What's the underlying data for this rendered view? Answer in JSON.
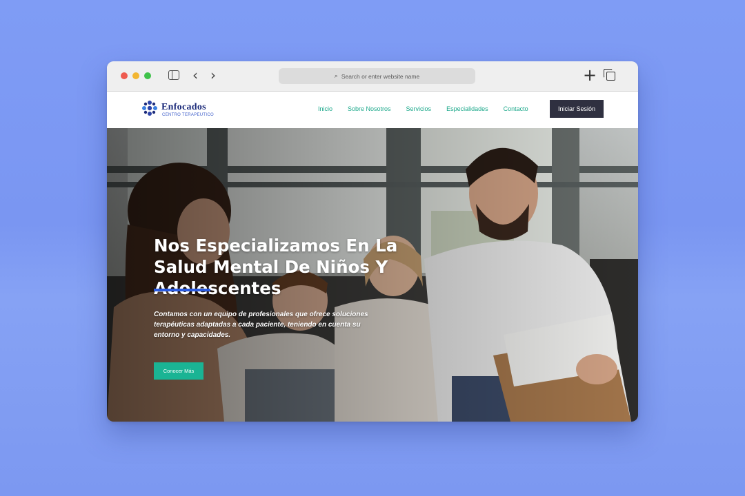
{
  "browser": {
    "address_placeholder": "Search or enter website name",
    "icons": [
      "sidebar-icon",
      "back-arrow-icon",
      "forward-arrow-icon",
      "search-icon",
      "new-tab-icon",
      "tabs-overview-icon"
    ]
  },
  "site": {
    "logo": {
      "name": "Enfocados",
      "subtitle": "CENTRO TERAPEUTICO"
    },
    "nav": [
      "Inicio",
      "Sobre Nosotros",
      "Servicios",
      "Especialidades",
      "Contacto"
    ],
    "login_label": "Iniciar Sesión",
    "accent_color": "#1ab494",
    "nav_color": "#1ba88a"
  },
  "hero": {
    "title": "Nos Especializamos En La Salud Mental De Niños Y Adolescentes",
    "description": "Contamos con un equipo de profesionales que ofrece soluciones terapéuticas adaptadas a cada paciente, teniendo en cuenta su entorno y capacidades.",
    "cta_label": "Conocer Más"
  }
}
